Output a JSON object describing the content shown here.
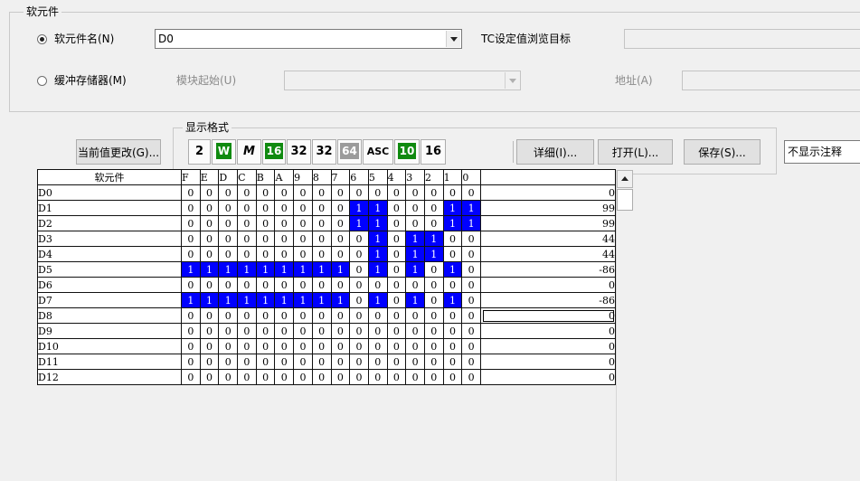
{
  "device_group": {
    "title": "软元件",
    "radio_device_name": "软元件名(N)",
    "device_name_value": "D0",
    "tc_label": "TC设定值浏览目标",
    "radio_buffer": "缓冲存储器(M)",
    "module_start_label": "模块起始(U)",
    "address_label": "地址(A)"
  },
  "display_format": {
    "title": "显示格式",
    "buttons": [
      "2",
      "W",
      "M",
      "16",
      "32",
      "32",
      "64",
      "ASC",
      "10",
      "16"
    ],
    "detail_label": "详细(I)...",
    "open_label": "打开(L)...",
    "save_label": "保存(S)..."
  },
  "change_value_label": "当前值更改(G)...",
  "comment_select_value": "不显示注释",
  "table": {
    "device_header": "软元件",
    "bit_headers": [
      "F",
      "E",
      "D",
      "C",
      "B",
      "A",
      "9",
      "8",
      "7",
      "6",
      "5",
      "4",
      "3",
      "2",
      "1",
      "0"
    ],
    "rows": [
      {
        "device": "D0",
        "bits": "0000000000000000",
        "value": "0"
      },
      {
        "device": "D1",
        "bits": "0000000001100011",
        "value": "99"
      },
      {
        "device": "D2",
        "bits": "0000000001100011",
        "value": "99"
      },
      {
        "device": "D3",
        "bits": "0000000000101100",
        "value": "44"
      },
      {
        "device": "D4",
        "bits": "0000000000101100",
        "value": "44"
      },
      {
        "device": "D5",
        "bits": "1111111110101010",
        "value": "-86"
      },
      {
        "device": "D6",
        "bits": "0000000000000000",
        "value": "0"
      },
      {
        "device": "D7",
        "bits": "1111111110101010",
        "value": "-86"
      },
      {
        "device": "D8",
        "bits": "0000000000000000",
        "value": "0",
        "selected": true
      },
      {
        "device": "D9",
        "bits": "0000000000000000",
        "value": "0"
      },
      {
        "device": "D10",
        "bits": "0000000000000000",
        "value": "0"
      },
      {
        "device": "D11",
        "bits": "0000000000000000",
        "value": "0"
      },
      {
        "device": "D12",
        "bits": "0000000000000000",
        "value": "0"
      }
    ]
  },
  "colors": {
    "bit_on": "#0000ff",
    "format_green": "#108a10"
  }
}
